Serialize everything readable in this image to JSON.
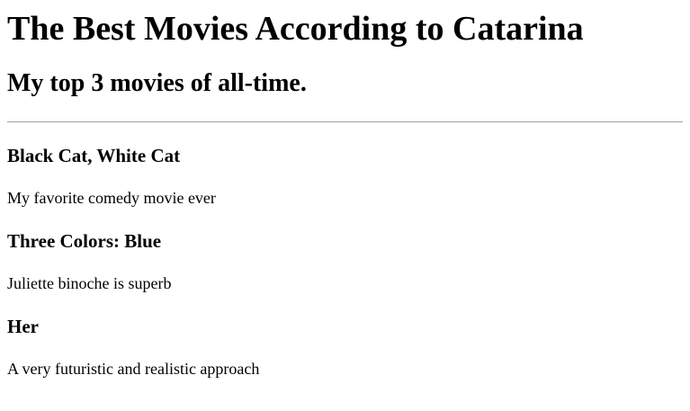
{
  "page": {
    "title": "The Best Movies According to Catarina",
    "subtitle": "My top 3 movies of all-time."
  },
  "movies": [
    {
      "title": "Black Cat, White Cat",
      "description": "My favorite comedy movie ever"
    },
    {
      "title": "Three Colors: Blue",
      "description": "Juliette binoche is superb"
    },
    {
      "title": "Her",
      "description": "A very futuristic and realistic approach"
    }
  ]
}
